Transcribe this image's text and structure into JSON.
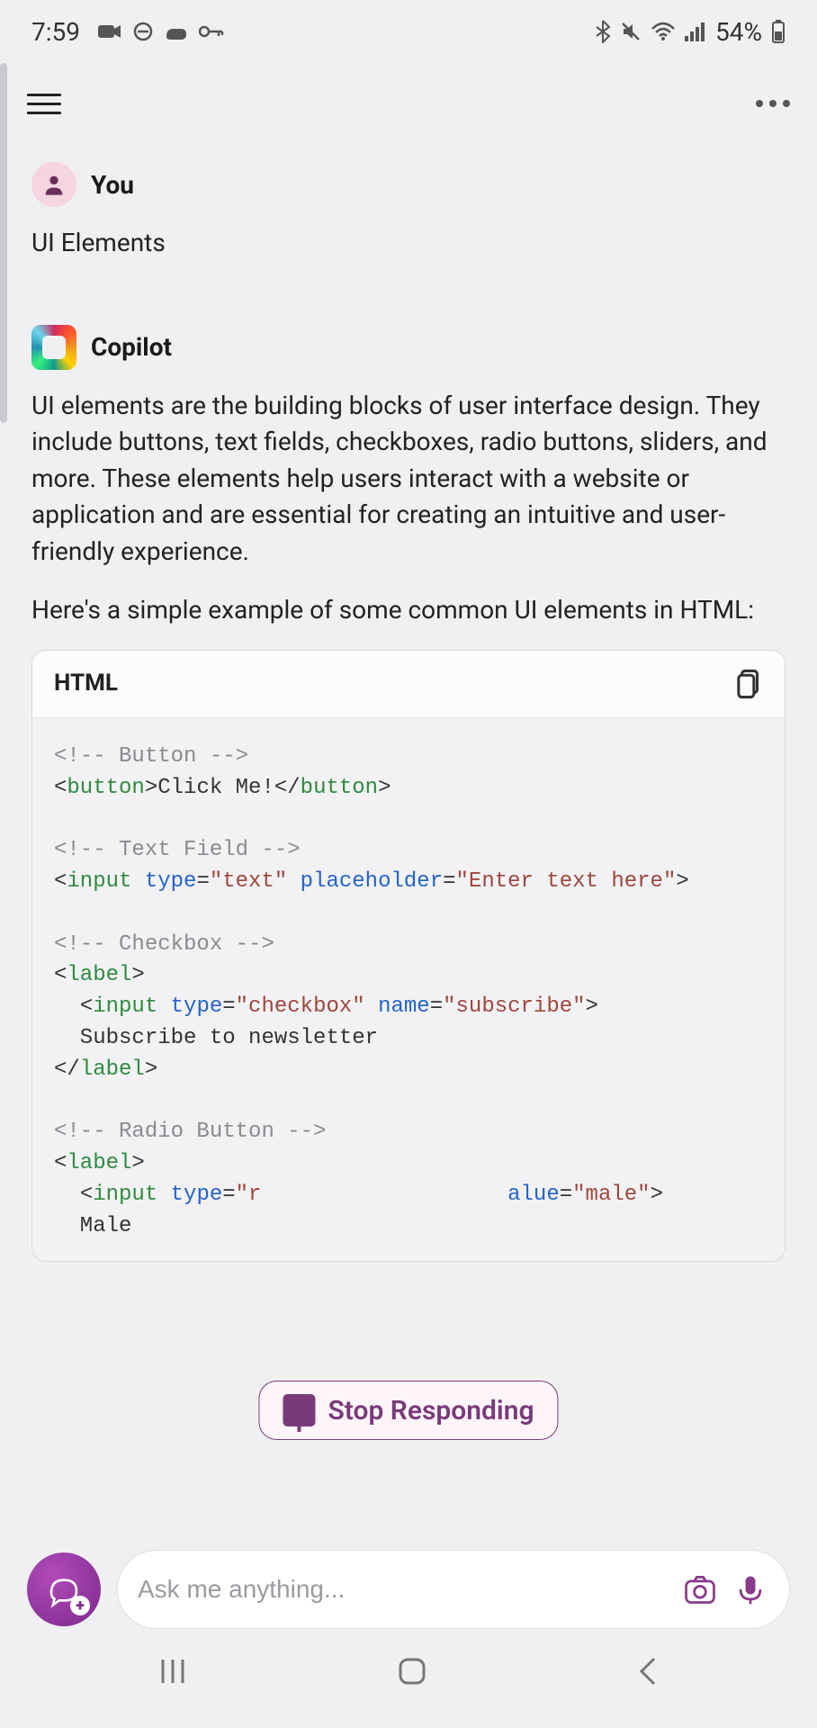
{
  "status": {
    "time": "7:59",
    "battery_label": "54%"
  },
  "chat": {
    "user": {
      "name": "You",
      "message": "UI Elements"
    },
    "assistant": {
      "name": "Copilot",
      "paragraph1": "UI elements are the building blocks of user interface design. They include buttons, text fields, checkboxes, radio buttons, sliders, and more. These elements help users interact with a website or application and are essential for creating an intuitive and user-friendly experience.",
      "paragraph2": "Here's a simple example of some common UI elements in HTML:",
      "code_lang": "HTML",
      "code": {
        "c1": "<!-- Button -->",
        "l2": {
          "open": "<",
          "tag": "button",
          "mid": ">",
          "text": "Click Me!",
          "close": "</",
          "tagc": "button",
          "end": ">"
        },
        "c3": "<!-- Text Field -->",
        "l4": {
          "open": "<",
          "tag": "input",
          "sp": " ",
          "a1": "type",
          "eq": "=",
          "v1": "\"text\"",
          "a2": "placeholder",
          "v2": "\"Enter text here\"",
          "end": ">"
        },
        "c5": "<!-- Checkbox -->",
        "l6": {
          "open": "<",
          "tag": "label",
          "end": ">"
        },
        "l7": {
          "indent": "  ",
          "open": "<",
          "tag": "input",
          "a1": "type",
          "v1": "\"checkbox\"",
          "a2": "name",
          "v2": "\"subscribe\"",
          "end": ">"
        },
        "l8": "  Subscribe to newsletter",
        "l9": {
          "open": "</",
          "tag": "label",
          "end": ">"
        },
        "c10": "<!-- Radio Button -->",
        "l11": {
          "open": "<",
          "tag": "label",
          "end": ">"
        },
        "l12": {
          "indent": "  ",
          "open": "<",
          "tag": "input",
          "a1": "type",
          "v1p": "\"r",
          "a3": "alue",
          "v3": "\"male\"",
          "end": ">"
        },
        "l13": "  Male"
      }
    }
  },
  "stop": {
    "label": "Stop Responding"
  },
  "input": {
    "placeholder": "Ask me anything..."
  }
}
